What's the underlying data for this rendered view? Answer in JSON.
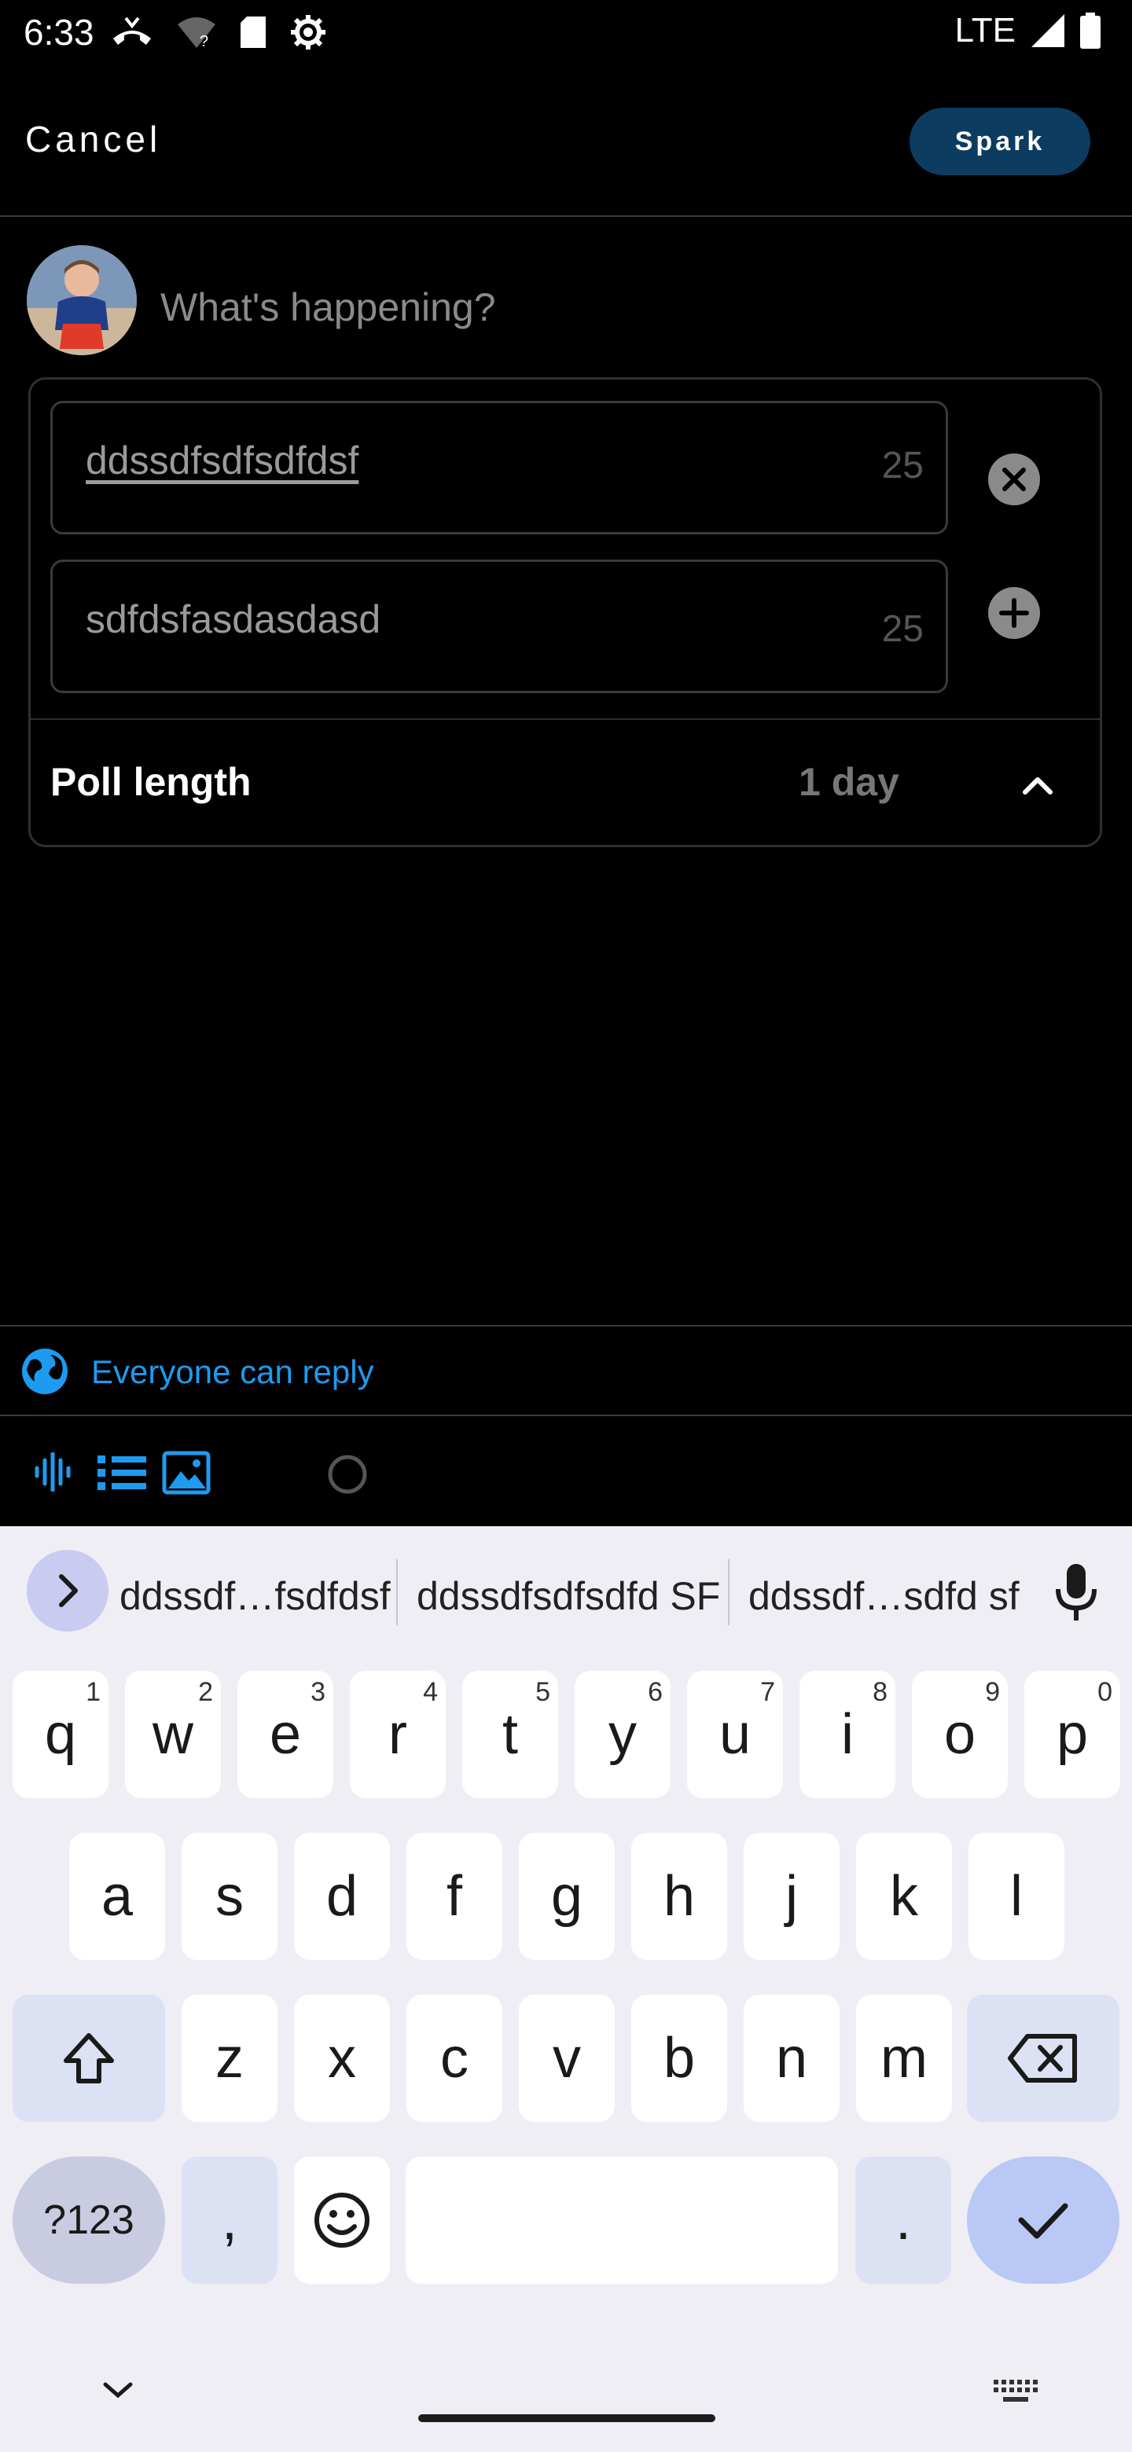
{
  "status_bar": {
    "time": "6:33",
    "network": "LTE",
    "icons": [
      "missed-call-icon",
      "wifi-unknown-icon",
      "sd-card-icon",
      "settings-gear-icon",
      "cell-signal-icon",
      "battery-icon"
    ]
  },
  "header": {
    "cancel_label": "Cancel",
    "spark_label": "Spark"
  },
  "composer": {
    "placeholder": "What's happening?"
  },
  "poll": {
    "choices": [
      {
        "value": "ddssdfsdfsdfdsf",
        "count": "25"
      },
      {
        "value": "sdfdsfasdasdasd",
        "count": "25"
      }
    ],
    "length_label": "Poll length",
    "length_value": "1 day"
  },
  "reply": {
    "label": "Everyone can reply"
  },
  "toolbar": {
    "icons": [
      "audio-wave-icon",
      "list-icon",
      "image-icon",
      "circle-progress-icon"
    ]
  },
  "keyboard": {
    "suggestions": [
      "ddssdf…fsdfdsf",
      "ddssdfsdfsdfd SF",
      "ddssdf…sdfd sf"
    ],
    "row1": [
      {
        "k": "q",
        "n": "1"
      },
      {
        "k": "w",
        "n": "2"
      },
      {
        "k": "e",
        "n": "3"
      },
      {
        "k": "r",
        "n": "4"
      },
      {
        "k": "t",
        "n": "5"
      },
      {
        "k": "y",
        "n": "6"
      },
      {
        "k": "u",
        "n": "7"
      },
      {
        "k": "i",
        "n": "8"
      },
      {
        "k": "o",
        "n": "9"
      },
      {
        "k": "p",
        "n": "0"
      }
    ],
    "row2": [
      "a",
      "s",
      "d",
      "f",
      "g",
      "h",
      "j",
      "k",
      "l"
    ],
    "row3": [
      "z",
      "x",
      "c",
      "v",
      "b",
      "n",
      "m"
    ],
    "symbols_label": "?123",
    "comma_label": ",",
    "period_label": "."
  },
  "colors": {
    "accent": "#1d9bf0",
    "spark_button": "#0c3c60",
    "keyboard_bg": "#f0eef5"
  }
}
